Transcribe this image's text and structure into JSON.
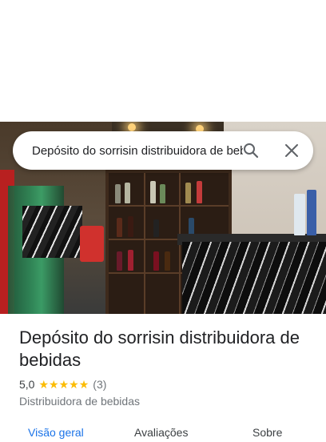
{
  "search": {
    "query": "Depósito do sorrisin distribuidora de bebidas",
    "search_icon": "search-icon",
    "close_icon": "close-icon"
  },
  "place": {
    "name": "Depósito do sorrisin distribuidora de bebidas",
    "rating": "5,0",
    "stars": 5,
    "review_count": "(3)",
    "category": "Distribuidora de bebidas"
  },
  "tabs": [
    {
      "label": "Visão geral",
      "active": true
    },
    {
      "label": "Avaliações",
      "active": false
    },
    {
      "label": "Sobre",
      "active": false
    }
  ],
  "colors": {
    "accent": "#1a73e8",
    "star": "#fbbc04"
  }
}
